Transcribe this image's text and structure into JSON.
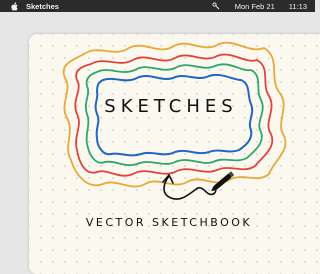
{
  "menubar": {
    "app_name": "Sketches",
    "date": "Mon Feb 21",
    "time": "11:13",
    "icons": [
      "apple-icon",
      "control-center-icon"
    ]
  },
  "canvas": {
    "title": "SKETCHES",
    "subtitle": "VECTOR SKETCHBOOK"
  },
  "colors": {
    "menubar_bg": "#2b2b2b",
    "canvas_bg": "#fbf8ef",
    "ring_orange": "#e8a93a",
    "ring_red": "#e0443e",
    "ring_green": "#2fa66a",
    "ring_blue": "#1f67c6"
  }
}
